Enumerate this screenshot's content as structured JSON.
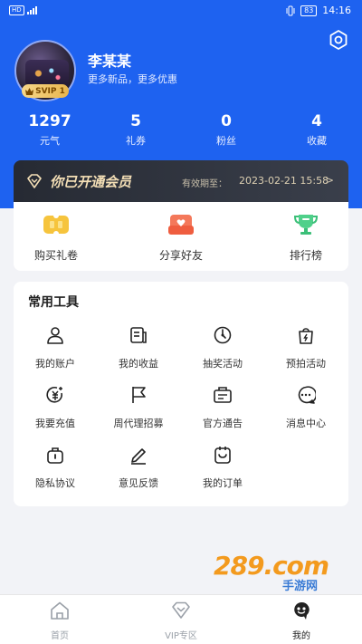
{
  "status_bar": {
    "left": "HD 4G",
    "battery": "83",
    "time": "14:16"
  },
  "profile": {
    "name": "李某某",
    "slogan": "更多新品，更多优惠",
    "badge": "SVIP 1"
  },
  "stats": [
    {
      "value": "1297",
      "label": "元气"
    },
    {
      "value": "5",
      "label": "礼券"
    },
    {
      "value": "0",
      "label": "粉丝"
    },
    {
      "value": "4",
      "label": "收藏"
    }
  ],
  "vip": {
    "title": "你已开通会员",
    "expire_label": "有效期至：",
    "expire_date": "2023-02-21 15:58",
    "arrow": ">"
  },
  "quick_actions": [
    {
      "label": "购买礼卷",
      "icon": "coupon-icon"
    },
    {
      "label": "分享好友",
      "icon": "share-icon"
    },
    {
      "label": "排行榜",
      "icon": "trophy-icon"
    }
  ],
  "tools": {
    "title": "常用工具",
    "items": [
      {
        "label": "我的账户",
        "icon": "user-icon"
      },
      {
        "label": "我的收益",
        "icon": "earnings-icon"
      },
      {
        "label": "抽奖活动",
        "icon": "lottery-icon"
      },
      {
        "label": "预拍活动",
        "icon": "bag-icon"
      },
      {
        "label": "我要充值",
        "icon": "recharge-icon"
      },
      {
        "label": "周代理招募",
        "icon": "flag-icon"
      },
      {
        "label": "官方通告",
        "icon": "notice-icon"
      },
      {
        "label": "消息中心",
        "icon": "message-icon"
      },
      {
        "label": "隐私协议",
        "icon": "privacy-icon"
      },
      {
        "label": "意见反馈",
        "icon": "feedback-icon"
      },
      {
        "label": "我的订单",
        "icon": "order-icon"
      }
    ]
  },
  "tabbar": [
    {
      "label": "首页",
      "icon": "home-icon",
      "active": false
    },
    {
      "label": "VIP专区",
      "icon": "vip-icon",
      "active": false
    },
    {
      "label": "我的",
      "icon": "mine-icon",
      "active": true
    }
  ],
  "watermark": {
    "main": "289.com",
    "sub": "手游网"
  },
  "colors": {
    "brand_blue": "#1e62f0",
    "vip_gold": "#f4dfb6",
    "background": "#f2f3f7"
  }
}
